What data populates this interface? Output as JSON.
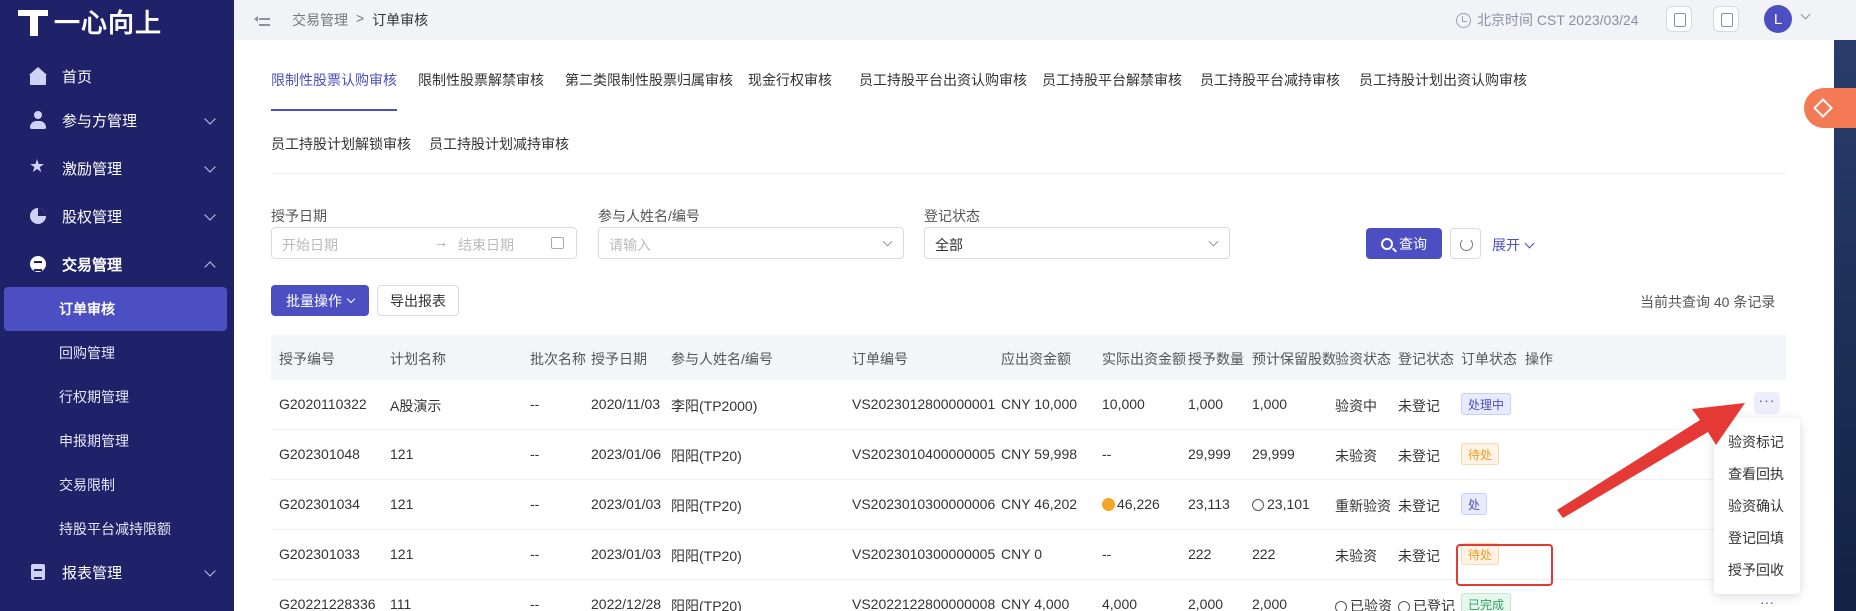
{
  "brand": {
    "name": "一心向上"
  },
  "sidebar": {
    "items": [
      {
        "label": "首页"
      },
      {
        "label": "参与方管理"
      },
      {
        "label": "激励管理"
      },
      {
        "label": "股权管理"
      },
      {
        "label": "交易管理"
      },
      {
        "label": "报表管理"
      }
    ],
    "sub_items": [
      {
        "label": "订单审核"
      },
      {
        "label": "回购管理"
      },
      {
        "label": "行权期管理"
      },
      {
        "label": "申报期管理"
      },
      {
        "label": "交易限制"
      },
      {
        "label": "持股平台减持限额"
      }
    ]
  },
  "header": {
    "breadcrumb": [
      "交易管理",
      ">",
      "订单审核"
    ],
    "time": "北京时间 CST 2023/03/24",
    "avatar": "L"
  },
  "tabs": [
    {
      "label": "限制性股票认购审核"
    },
    {
      "label": "限制性股票解禁审核"
    },
    {
      "label": "第二类限制性股票归属审核"
    },
    {
      "label": "现金行权审核"
    },
    {
      "label": "员工持股平台出资认购审核"
    },
    {
      "label": "员工持股平台解禁审核"
    },
    {
      "label": "员工持股平台减持审核"
    },
    {
      "label": "员工持股计划出资认购审核"
    },
    {
      "label": "员工持股计划解锁审核"
    },
    {
      "label": "员工持股计划减持审核"
    }
  ],
  "filters": {
    "grant_date_label": "授予日期",
    "start_placeholder": "开始日期",
    "arrow": "→",
    "end_placeholder": "结束日期",
    "participant_label": "参与人姓名/编号",
    "participant_placeholder": "请输入",
    "status_label": "登记状态",
    "status_value": "全部",
    "search_label": "查询",
    "expand_label": "展开"
  },
  "toolbar": {
    "batch_label": "批量操作",
    "export_label": "导出报表",
    "record_count": "当前共查询 40 条记录"
  },
  "table": {
    "columns": [
      "授予编号",
      "计划名称",
      "批次名称",
      "授予日期",
      "参与人姓名/编号",
      "订单编号",
      "应出资金额",
      "实际出资金额",
      "授予数量",
      "预计保留股数",
      "验资状态",
      "登记状态",
      "订单状态",
      "操作"
    ],
    "rows": [
      {
        "grant_no": "G2020110322",
        "plan": "A股演示",
        "batch": "--",
        "date": "2020/11/03",
        "participant": "李阳(TP2000)",
        "order_no": "VS2023012800000001",
        "due": "CNY 10,000",
        "actual": "10,000",
        "qty": "1,000",
        "reserve": "1,000",
        "verify": "验资中",
        "register": "未登记",
        "status": "处理中",
        "more": "···"
      },
      {
        "grant_no": "G202301048",
        "plan": "121",
        "batch": "--",
        "date": "2023/01/06",
        "participant": "阳阳(TP20)",
        "order_no": "VS2023010400000005",
        "due": "CNY 59,998",
        "actual": "--",
        "qty": "29,999",
        "reserve": "29,999",
        "verify": "未验资",
        "register": "未登记",
        "status": "待处",
        "more": ""
      },
      {
        "grant_no": "G202301034",
        "plan": "121",
        "batch": "--",
        "date": "2023/01/03",
        "participant": "阳阳(TP20)",
        "order_no": "VS2023010300000006",
        "due": "CNY 46,202",
        "actual": "46,226",
        "qty": "23,113",
        "reserve": "23,101",
        "verify": "重新验资",
        "register": "未登记",
        "status": "处",
        "more": ""
      },
      {
        "grant_no": "G202301033",
        "plan": "121",
        "batch": "--",
        "date": "2023/01/03",
        "participant": "阳阳(TP20)",
        "order_no": "VS2023010300000005",
        "due": "CNY 0",
        "actual": "--",
        "qty": "222",
        "reserve": "222",
        "verify": "未验资",
        "register": "未登记",
        "status": "待处",
        "more": ""
      },
      {
        "grant_no": "G20221228336",
        "plan": "111",
        "batch": "--",
        "date": "2022/12/28",
        "participant": "阳阳(TP20)",
        "order_no": "VS2022122800000008",
        "due": "CNY 4,000",
        "actual": "4,000",
        "qty": "2,000",
        "reserve": "2,000",
        "verify": "已验资",
        "register": "已登记",
        "status": "已完成",
        "more": "···"
      }
    ]
  },
  "menu": {
    "items": [
      "验资标记",
      "查看回执",
      "验资确认",
      "登记回填",
      "授予回收"
    ]
  },
  "colors": {
    "primary": "#4b4fc1",
    "sidebar": "#1f2268",
    "annotation": "#e53935"
  }
}
